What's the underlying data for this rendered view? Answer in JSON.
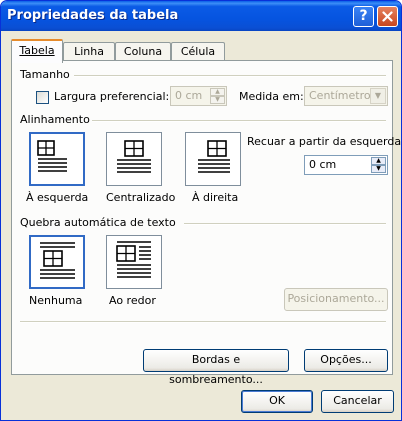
{
  "window": {
    "title": "Propriedades da tabela",
    "help_icon": "question-mark",
    "close_icon": "x-mark"
  },
  "tabs": [
    {
      "label": "Tabela",
      "active": true
    },
    {
      "label": "Linha",
      "active": false
    },
    {
      "label": "Coluna",
      "active": false
    },
    {
      "label": "Célula",
      "active": false
    }
  ],
  "size": {
    "section_label": "Tamanho",
    "preferred_width_label": "Largura preferencial:",
    "preferred_width_checked": false,
    "preferred_width_value": "0 cm",
    "measure_in_label": "Medida em:",
    "measure_in_value": "Centímetros"
  },
  "alignment": {
    "section_label": "Alinhamento",
    "options": [
      {
        "label": "À esquerda",
        "selected": true
      },
      {
        "label": "Centralizado",
        "selected": false
      },
      {
        "label": "À direita",
        "selected": false
      }
    ],
    "indent_label": "Recuar a partir da esquerda:",
    "indent_value": "0 cm"
  },
  "text_wrapping": {
    "section_label": "Quebra automática de texto",
    "options": [
      {
        "label": "Nenhuma",
        "selected": true
      },
      {
        "label": "Ao redor",
        "selected": false
      }
    ],
    "positioning_button": "Posicionamento..."
  },
  "buttons": {
    "borders_shading": "Bordas e sombreamento...",
    "options": "Opções...",
    "ok": "OK",
    "cancel": "Cancelar"
  },
  "colors": {
    "titlebar": "#0654e0",
    "selection_border": "#316ac5",
    "dialog_bg": "#ece9d8",
    "active_tab_accent": "#e68b2c"
  }
}
